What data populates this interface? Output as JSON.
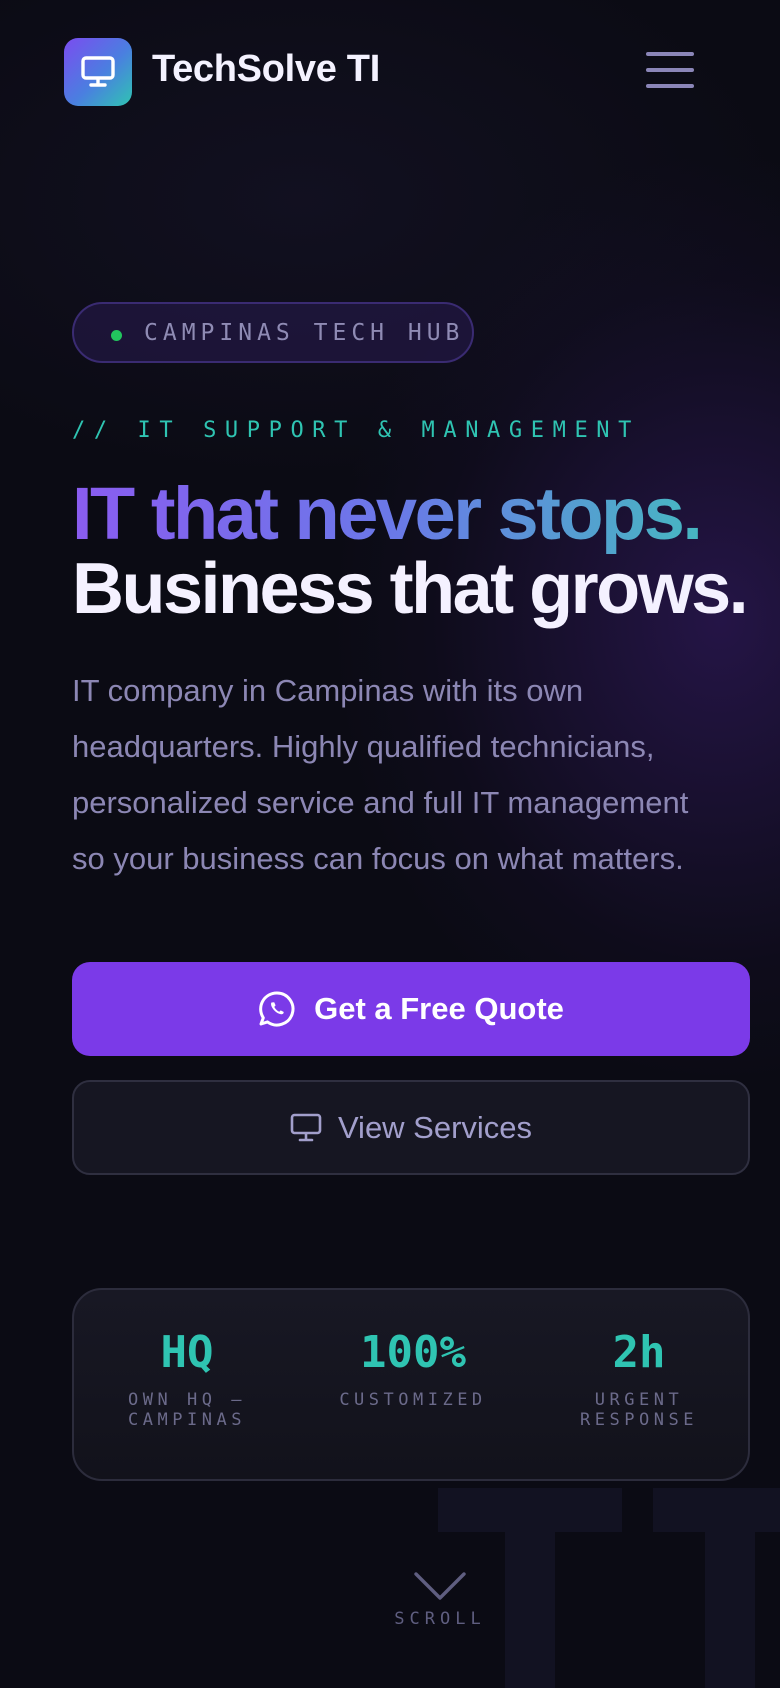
{
  "header": {
    "brand": "TechSolve TI",
    "logo_icon": "monitor-icon",
    "menu_icon": "hamburger-menu-icon"
  },
  "hero": {
    "badge": "CAMPINAS TECH HUB",
    "eyebrow": "// IT SUPPORT & MANAGEMENT",
    "title_line1": "IT that never stops.",
    "title_line2": "Business that grows.",
    "description": "IT company in Campinas with its own headquarters. Highly qualified technicians, personalized service and full IT management so your business can focus on what matters."
  },
  "actions": {
    "primary_label": "Get a Free Quote",
    "primary_icon": "whatsapp-icon",
    "secondary_label": "View Services",
    "secondary_icon": "monitor-icon"
  },
  "stats": [
    {
      "value": "HQ",
      "label": "OWN HQ — CAMPINAS"
    },
    {
      "value": "100%",
      "label": "CUSTOMIZED"
    },
    {
      "value": "2h",
      "label": "URGENT RESPONSE"
    }
  ],
  "scroll": {
    "label": "SCROLL",
    "icon": "chevron-down-icon"
  },
  "colors": {
    "background": "#0b0b14",
    "accent_purple": "#7b3ae8",
    "accent_teal": "#2fc4b2",
    "status_green": "#22c55e",
    "muted_text": "#8c87b4"
  }
}
